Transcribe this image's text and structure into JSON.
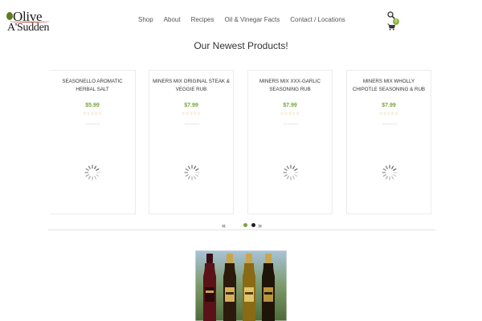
{
  "header": {
    "logo": {
      "line1": "Olive",
      "line2": "A'Sudden"
    },
    "nav": [
      {
        "label": "Shop"
      },
      {
        "label": "About"
      },
      {
        "label": "Recipes"
      },
      {
        "label": "Oil & Vinegar Facts"
      },
      {
        "label": "Contact / Locations"
      }
    ],
    "cart_count": "0"
  },
  "main": {
    "title": "Our Newest Products!",
    "products": [
      {
        "name": "SEASONELLO AROMATIC HERBAL SALT",
        "price": "$5.99",
        "stars": "☆☆☆☆☆"
      },
      {
        "name": "MINERS MIX ORIGINAL STEAK & VEGGIE RUB",
        "price": "$7.99",
        "stars": "☆☆☆☆☆"
      },
      {
        "name": "MINERS MIX XXX-GARLIC SEASONING RUB",
        "price": "$7.99",
        "stars": "☆☆☆☆☆"
      },
      {
        "name": "MINERS MIX WHOLLY CHIPOTLE SEASONING & RUB",
        "price": "$7.99",
        "stars": "☆☆☆☆☆"
      }
    ],
    "carousel": {
      "prev": "«",
      "next": "»"
    }
  },
  "colors": {
    "accent": "#7aa33a",
    "star": "#d9a45a",
    "badge": "#8bb43b"
  },
  "icons": [
    "search-icon",
    "cart-icon",
    "loading-spinner-icon"
  ]
}
